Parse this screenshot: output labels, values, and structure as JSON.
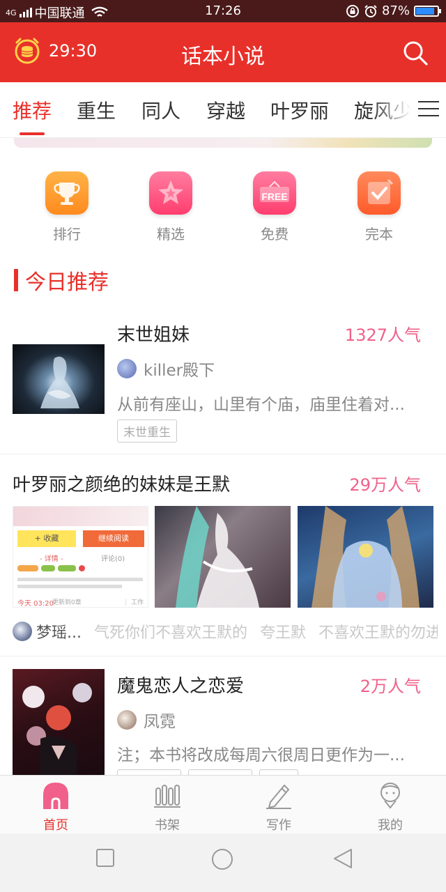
{
  "status_bar": {
    "carrier": "中国联通",
    "network": "4G",
    "time": "17:26",
    "battery": "87%",
    "battery_level": 0.87
  },
  "header": {
    "timer": "29:30",
    "title": "话本小说",
    "accent_color": "#e8302a"
  },
  "tabs": [
    {
      "label": "推荐",
      "active": true
    },
    {
      "label": "重生"
    },
    {
      "label": "同人"
    },
    {
      "label": "穿越"
    },
    {
      "label": "叶罗丽"
    },
    {
      "label": "旋风少"
    }
  ],
  "quick_links": [
    {
      "label": "排行",
      "icon": "trophy-icon",
      "color": "#ff9a2e"
    },
    {
      "label": "精选",
      "icon": "star-icon",
      "color": "#ff4f7b"
    },
    {
      "label": "免费",
      "icon": "free-tag-icon",
      "icon_text": "FREE",
      "color": "#ff4f7b"
    },
    {
      "label": "完本",
      "icon": "checkmark-icon",
      "color": "#ff6a3d"
    }
  ],
  "section": {
    "title": "今日推荐"
  },
  "books": [
    {
      "title": "末世姐妹",
      "popularity": "1327人气",
      "author": "killer殿下",
      "description": "从前有座山，山里有个庙，庙里住着对...",
      "tags": [
        "末世重生"
      ]
    },
    {
      "title": "叶罗丽之颜绝的妹妹是王默",
      "popularity": "29万人气",
      "comment_author": "梦瑶...",
      "comments": [
        "气死你们不喜欢王默的",
        "夸王默",
        "不喜欢王默的勿进"
      ],
      "screenshot_buttons": {
        "collect": "+ 收藏",
        "continue": "继续阅读"
      },
      "screenshot_tabs": {
        "detail": "- 详情 -",
        "comments": "评论(0)"
      },
      "screenshot_footer": {
        "time": "今天 03:20",
        "note": "更新到0章",
        "menu": "⋮ 工作"
      }
    },
    {
      "title": "魔鬼恋人之恋爱",
      "popularity": "2万人气",
      "author": "凤霓",
      "description": "注；本书将改成每周六很周日更作为一..."
    }
  ],
  "bottom_nav": [
    {
      "label": "首页",
      "icon": "home-icon",
      "active": true
    },
    {
      "label": "书架",
      "icon": "bookshelf-icon"
    },
    {
      "label": "写作",
      "icon": "pencil-icon"
    },
    {
      "label": "我的",
      "icon": "profile-icon"
    }
  ]
}
